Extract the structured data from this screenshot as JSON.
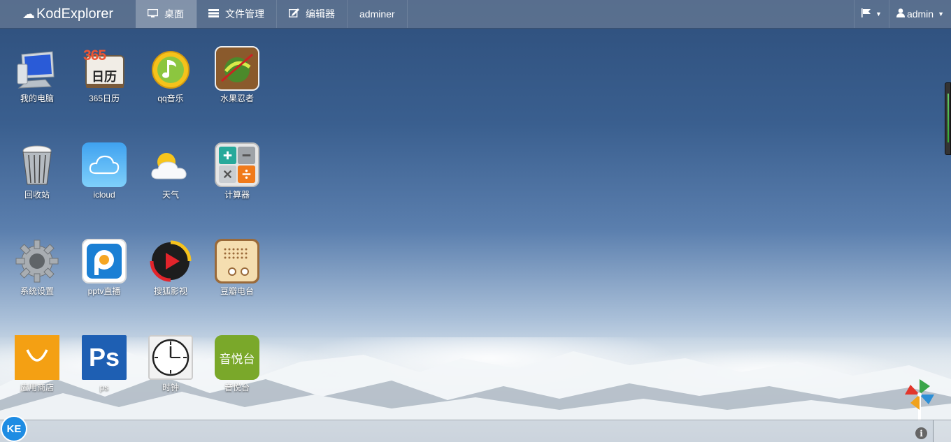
{
  "brand": {
    "name": "KodExplorer"
  },
  "nav": {
    "items": [
      {
        "label": "桌面",
        "icon": "desktop-icon"
      },
      {
        "label": "文件管理",
        "icon": "list-icon"
      },
      {
        "label": "编辑器",
        "icon": "edit-icon"
      },
      {
        "label": "adminer"
      }
    ]
  },
  "user": {
    "name": "admin"
  },
  "desktop": {
    "apps": [
      {
        "label": "我的电脑",
        "icon": "computer-icon"
      },
      {
        "label": "365日历",
        "icon": "calendar-icon",
        "badge": "365",
        "sub": "日历"
      },
      {
        "label": "qq音乐",
        "icon": "music-icon"
      },
      {
        "label": "水果忍者",
        "icon": "fruit-ninja-icon"
      },
      {
        "label": "回收站",
        "icon": "trash-icon"
      },
      {
        "label": "icloud",
        "icon": "cloud-icon"
      },
      {
        "label": "天气",
        "icon": "weather-icon"
      },
      {
        "label": "计算器",
        "icon": "calculator-icon"
      },
      {
        "label": "系统设置",
        "icon": "gear-icon"
      },
      {
        "label": "pptv直播",
        "icon": "pptv-icon"
      },
      {
        "label": "搜狐影视",
        "icon": "video-icon"
      },
      {
        "label": "豆瓣电台",
        "icon": "radio-icon"
      },
      {
        "label": "应用商店",
        "icon": "store-icon"
      },
      {
        "label": "ps",
        "icon": "photoshop-icon",
        "text": "Ps"
      },
      {
        "label": "时钟",
        "icon": "clock-icon"
      },
      {
        "label": "音悦台",
        "icon": "yinyuetai-icon",
        "text": "音悦台"
      }
    ]
  },
  "taskbar": {
    "start_label": "KE",
    "info": "i"
  }
}
